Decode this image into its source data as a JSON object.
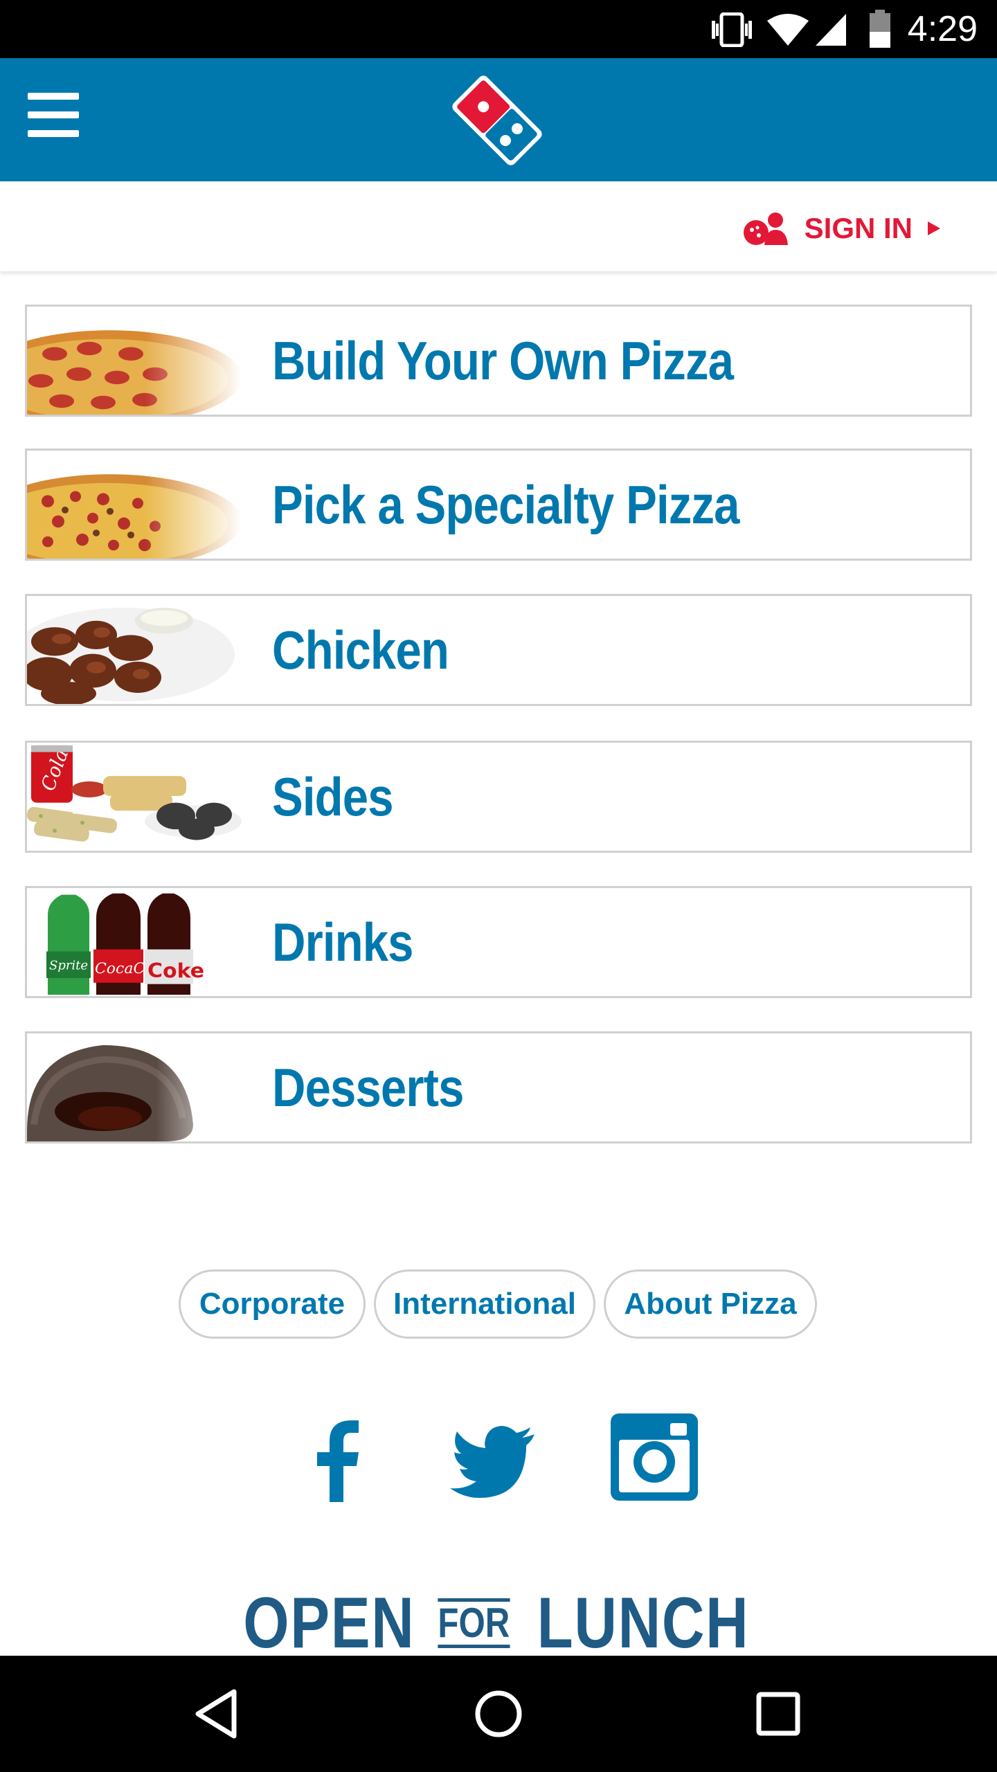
{
  "status_bar": {
    "time": "4:29",
    "icons": [
      "vibrate-icon",
      "wifi-icon",
      "signal-icon",
      "battery-icon"
    ]
  },
  "header": {
    "menu_icon": "hamburger-menu-icon",
    "logo": "dominos-logo"
  },
  "signin": {
    "label": "SIGN IN",
    "icon": "user-pizza-icon",
    "arrow_icon": "triangle-right-icon"
  },
  "menu": {
    "items": [
      {
        "label": "Build Your Own Pizza",
        "thumb": "pepperoni-pizza-image"
      },
      {
        "label": "Pick a Specialty Pizza",
        "thumb": "specialty-pizza-image"
      },
      {
        "label": "Chicken",
        "thumb": "chicken-wings-image"
      },
      {
        "label": "Sides",
        "thumb": "sides-image"
      },
      {
        "label": "Drinks",
        "thumb": "soda-bottles-image"
      },
      {
        "label": "Desserts",
        "thumb": "lava-cake-image"
      }
    ]
  },
  "footer": {
    "links": [
      "Corporate",
      "International",
      "About Pizza"
    ],
    "social": [
      "facebook-icon",
      "twitter-icon",
      "instagram-icon"
    ],
    "banner": {
      "open": "OPEN",
      "for": "FOR",
      "lunch": "LUNCH"
    }
  },
  "nav": {
    "back_icon": "back-triangle-icon",
    "home_icon": "home-circle-icon",
    "recents_icon": "recents-square-icon"
  },
  "colors": {
    "brand_blue": "#0078ae",
    "brand_red": "#e31837",
    "lunch_blue": "#1f5b85"
  }
}
